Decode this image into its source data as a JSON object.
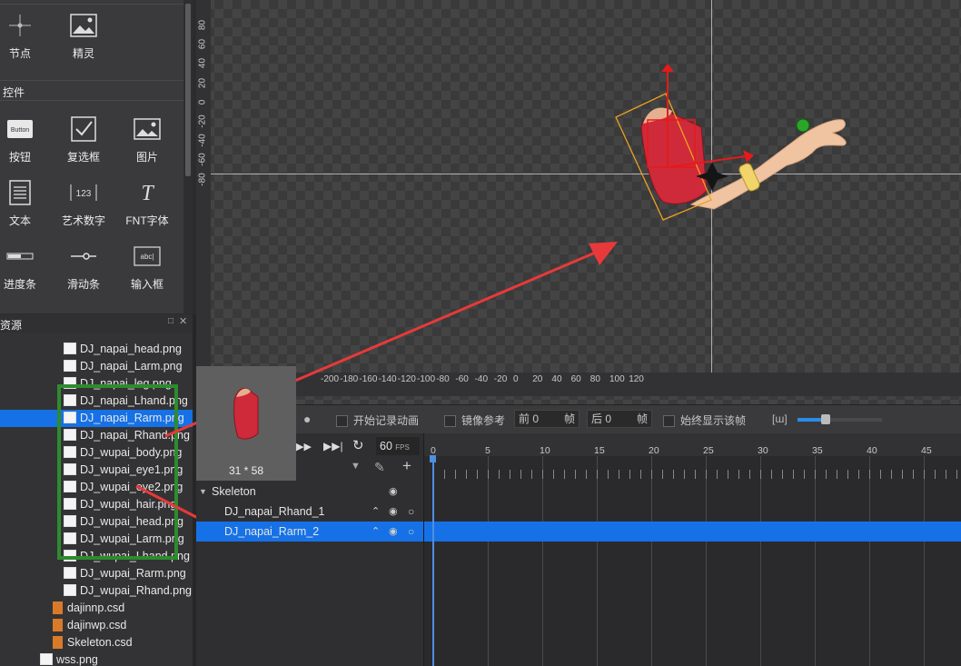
{
  "toolbox": {
    "nodes": [
      {
        "label": "节点",
        "icon": "node-icon"
      },
      {
        "label": "精灵",
        "icon": "sprite-icon"
      }
    ],
    "section_title": "控件",
    "widgets": [
      {
        "label": "按钮",
        "icon": "button-icon",
        "icon_text": "Button"
      },
      {
        "label": "复选框",
        "icon": "checkbox-icon"
      },
      {
        "label": "图片",
        "icon": "image-icon"
      },
      {
        "label": "文本",
        "icon": "text-icon"
      },
      {
        "label": "艺术数字",
        "icon": "art-number-icon",
        "icon_text": "123"
      },
      {
        "label": "FNT字体",
        "icon": "fnt-font-icon",
        "icon_text": "T"
      },
      {
        "label": "进度条",
        "icon": "progress-bar-icon"
      },
      {
        "label": "滑动条",
        "icon": "slider-icon"
      },
      {
        "label": "输入框",
        "icon": "input-box-icon",
        "icon_text": "abc|"
      }
    ]
  },
  "resources": {
    "title": "资源",
    "files": [
      {
        "name": "DJ_napai_head.png",
        "type": "png"
      },
      {
        "name": "DJ_napai_Larm.png",
        "type": "png"
      },
      {
        "name": "DJ_napai_leg.png",
        "type": "png"
      },
      {
        "name": "DJ_napai_Lhand.png",
        "type": "png"
      },
      {
        "name": "DJ_napai_Rarm.png",
        "type": "png",
        "selected": true
      },
      {
        "name": "DJ_napai_Rhand.png",
        "type": "png"
      },
      {
        "name": "DJ_wupai_body.png",
        "type": "png"
      },
      {
        "name": "DJ_wupai_eye1.png",
        "type": "png"
      },
      {
        "name": "DJ_wupai_eye2.png",
        "type": "png"
      },
      {
        "name": "DJ_wupai_hair.png",
        "type": "png"
      },
      {
        "name": "DJ_wupai_head.png",
        "type": "png"
      },
      {
        "name": "DJ_wupai_Larm.png",
        "type": "png"
      },
      {
        "name": "DJ_wupai_Lhand.png",
        "type": "png"
      },
      {
        "name": "DJ_wupai_Rarm.png",
        "type": "png"
      },
      {
        "name": "DJ_wupai_Rhand.png",
        "type": "png"
      }
    ],
    "csd_files": [
      "dajinnp.csd",
      "dajinwp.csd",
      "Skeleton.csd"
    ],
    "last_file": "wss.png"
  },
  "canvas": {
    "x_ticks": [
      "-200",
      "-180",
      "-160",
      "-140",
      "-120",
      "-100",
      "-80",
      "-60",
      "-40",
      "-20",
      "0",
      "20",
      "40",
      "60",
      "80",
      "100",
      "120"
    ],
    "y_ticks": [
      "80",
      "60",
      "40",
      "20",
      "0",
      "-20",
      "-40",
      "-60",
      "-80"
    ]
  },
  "preview": {
    "size_label": "31 * 58"
  },
  "timeline": {
    "record_label": "开始记录动画",
    "mirror_label": "镜像参考",
    "prev_label": "前",
    "prev_value": "0",
    "frame_unit": "帧",
    "next_label": "后",
    "next_value": "0",
    "always_show_label": "始终显示该帧",
    "fps_value": "60",
    "fps_unit": "FPS",
    "frame_numbers": [
      "0",
      "5",
      "10",
      "15",
      "20",
      "25",
      "30",
      "35",
      "40",
      "45"
    ],
    "tree": [
      {
        "label": "Skeleton",
        "level": 0
      },
      {
        "label": "DJ_napai_Rhand_1",
        "level": 1
      },
      {
        "label": "DJ_napai_Rarm_2",
        "level": 1,
        "selected": true
      }
    ]
  },
  "colors": {
    "accent": "#1671e6",
    "annotation_arrow": "#e8393a",
    "highlight_box": "#2e8b2e",
    "bounding_box": "#f0a020"
  }
}
